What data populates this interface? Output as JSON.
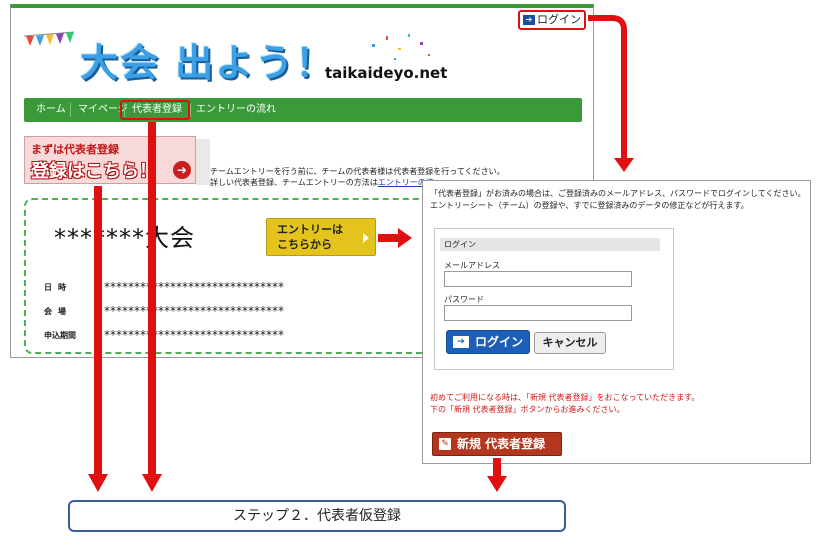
{
  "site": {
    "login_link": "ログイン",
    "logo_title": "大会 出よう！",
    "logo_sub": "taikaideyo.net",
    "nav": [
      "ホーム",
      "マイページ",
      "代表者登録",
      "エントリーの流れ"
    ],
    "banner_line1": "まずは代表者登録",
    "banner_line2": "登録はこちら！",
    "intro_line1": "チームエントリーを行う前に、チームの代表者様は代表者登録を行ってください。",
    "intro_line2": "詳しい代表者登録、チームエントリーの方法は",
    "intro_link": "エントリーの流",
    "event_title": "*******大会",
    "entry_button": "エントリーは\nこちらから",
    "info": [
      {
        "label": "日時",
        "value": "******************************"
      },
      {
        "label": "会場",
        "value": "******************************"
      },
      {
        "label": "申込期間",
        "value": "******************************"
      }
    ]
  },
  "login_panel": {
    "note_line1": "「代表者登録」がお済みの場合は、ご登録済みのメールアドレス、パスワードでログインしてください。",
    "note_line2": "エントリーシート（チーム）の登録や、すでに登録済みのデータの修正などが行えます。",
    "form_title": "ログイン",
    "email_label": "メールアドレス",
    "password_label": "パスワード",
    "login_button": "ログイン",
    "cancel_button": "キャンセル",
    "red_line1": "初めてご利用になる時は、「新規 代表者登録」をおこなっていただきます。",
    "red_line2": "下の「新規 代表者登録」ボタンからお進みください。",
    "new_button": "新規 代表者登録"
  },
  "step_caption": "ステップ２．代表者仮登録",
  "colors": {
    "nav_green": "#3a9a3a",
    "arrow_red": "#e01010",
    "login_blue": "#1d5fb8",
    "new_brown": "#b3371e"
  }
}
